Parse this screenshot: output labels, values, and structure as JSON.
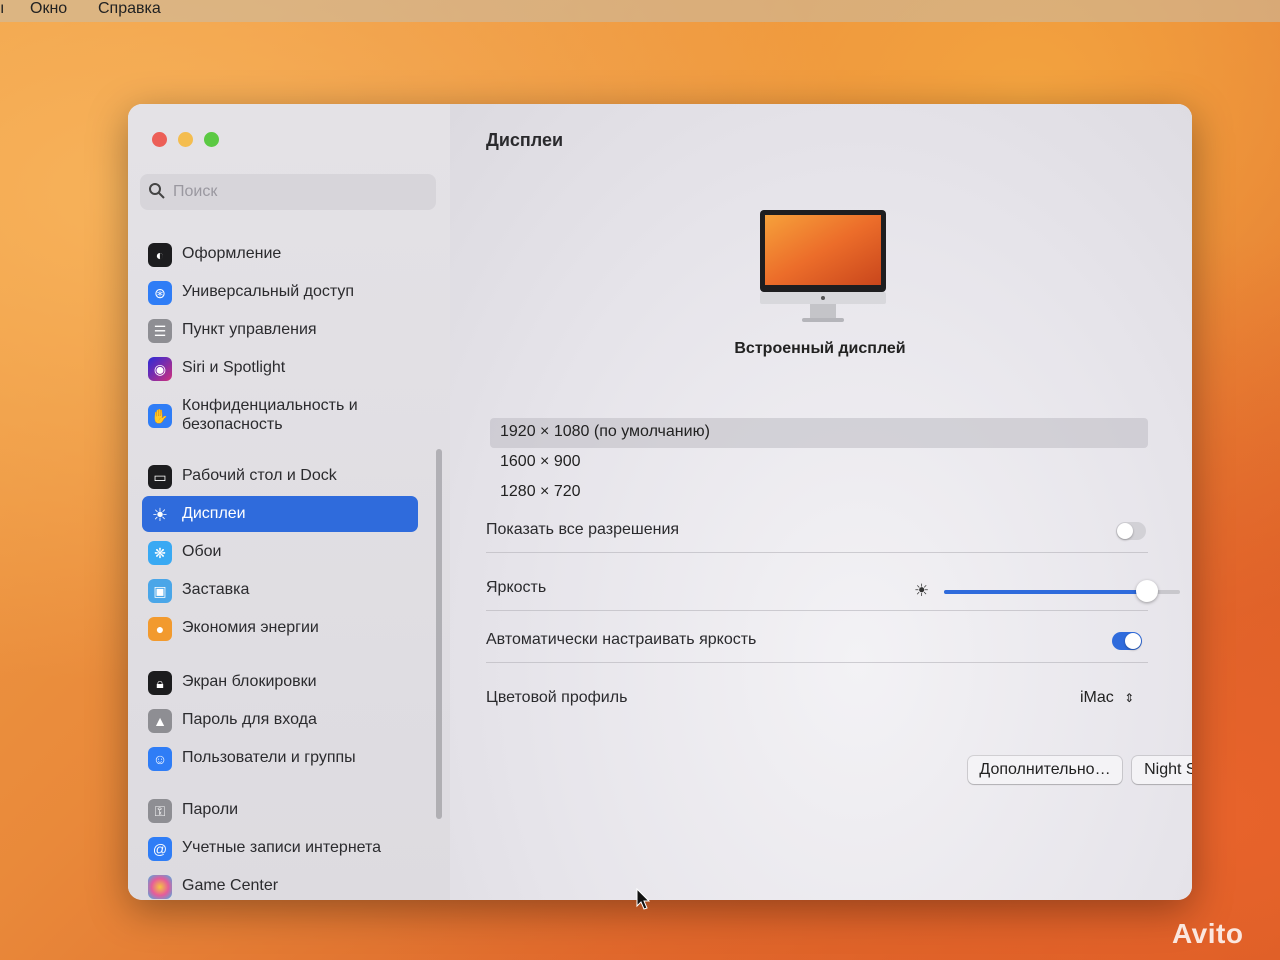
{
  "menubar": {
    "items": [
      "Окно",
      "Справка"
    ]
  },
  "window": {
    "traffic_colors": [
      "#ec5f57",
      "#f4bd4f",
      "#5bc943"
    ]
  },
  "sidebar": {
    "search_placeholder": "Поиск",
    "items": [
      {
        "label": "Оформление",
        "icon": "appearance-icon",
        "color": "#1c1c1e"
      },
      {
        "label": "Универсальный доступ",
        "icon": "accessibility-icon",
        "color": "#2f7df6"
      },
      {
        "label": "Пункт управления",
        "icon": "control-center-icon",
        "color": "#8e8e93"
      },
      {
        "label": "Siri и Spotlight",
        "icon": "siri-icon",
        "color": "#6b3fc7"
      },
      {
        "label": "Конфиденциальность и безопасность",
        "icon": "hand-icon",
        "color": "#2f7df6"
      },
      {
        "label": "Рабочий стол и Dock",
        "icon": "dock-icon",
        "color": "#1c1c1e"
      },
      {
        "label": "Дисплеи",
        "icon": "sun-icon",
        "color": "#2f7df6"
      },
      {
        "label": "Обои",
        "icon": "wallpaper-icon",
        "color": "#39a9f3"
      },
      {
        "label": "Заставка",
        "icon": "screensaver-icon",
        "color": "#4aa6e8"
      },
      {
        "label": "Экономия энергии",
        "icon": "bulb-icon",
        "color": "#f29a2e"
      },
      {
        "label": "Экран блокировки",
        "icon": "lock-screen-icon",
        "color": "#1c1c1e"
      },
      {
        "label": "Пароль для входа",
        "icon": "lock-icon",
        "color": "#8e8e93"
      },
      {
        "label": "Пользователи и группы",
        "icon": "users-icon",
        "color": "#2f7df6"
      },
      {
        "label": "Пароли",
        "icon": "key-icon",
        "color": "#8e8e93"
      },
      {
        "label": "Учетные записи интернета",
        "icon": "at-icon",
        "color": "#2f7df6"
      },
      {
        "label": "Game Center",
        "icon": "game-center-icon",
        "color": "#e55c9b"
      }
    ]
  },
  "main": {
    "title": "Дисплеи",
    "display_name": "Встроенный дисплей",
    "resolutions": [
      "1920 × 1080 (по умолчанию)",
      "1600 × 900",
      "1280 × 720"
    ],
    "show_all_label": "Показать все разрешения",
    "show_all_on": false,
    "brightness_label": "Яркость",
    "brightness_level": 0.86,
    "auto_brightness_label": "Автоматически настраивать яркость",
    "auto_brightness_on": true,
    "color_profile_label": "Цветовой профиль",
    "color_profile_value": "iMac",
    "advanced_button": "Дополнительно…",
    "night_shift_button": "Night Shift…",
    "help_button": "?",
    "accent_color": "#2f6bdc"
  },
  "watermark": "Avito"
}
